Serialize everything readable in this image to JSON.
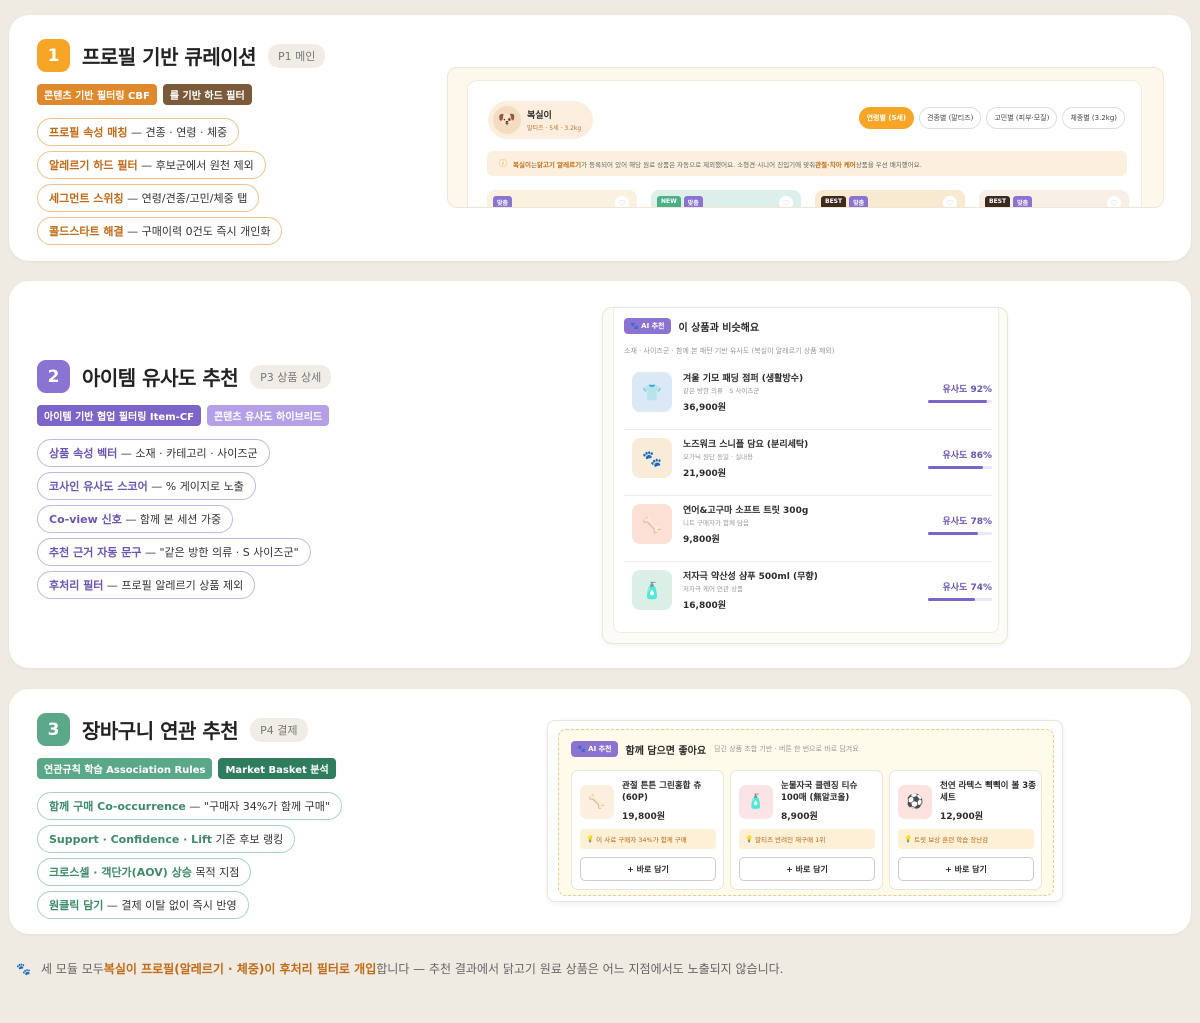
{
  "sections": [
    {
      "num": "1",
      "title": "프로필 기반 큐레이션",
      "page": "P1 메인",
      "chips": [
        "콘텐츠 기반 필터링 CBF",
        "룰 기반 하드 필터"
      ],
      "pills": [
        {
          "b": "프로필 속성 매칭",
          "t": " — 견종 · 연령 · 체중"
        },
        {
          "b": "알레르기 하드 필터",
          "t": " — 후보군에서 원천 제외"
        },
        {
          "b": "세그먼트 스위칭",
          "t": " — 연령/견종/고민/체중 탭"
        },
        {
          "b": "콜드스타트 해결",
          "t": " — 구매이력 0건도 즉시 개인화"
        }
      ]
    },
    {
      "num": "2",
      "title": "아이템 유사도 추천",
      "page": "P3 상품 상세",
      "chips": [
        "아이템 기반 협업 필터링 Item-CF",
        "콘텐츠 유사도 하이브리드"
      ],
      "pills": [
        {
          "b": "상품 속성 벡터",
          "t": " — 소재 · 카테고리 · 사이즈군"
        },
        {
          "b": "코사인 유사도 스코어",
          "t": " — % 게이지로 노출"
        },
        {
          "b": "Co-view 신호",
          "t": " — 함께 본 세션 가중"
        },
        {
          "b": "추천 근거 자동 문구",
          "t": " — \"같은 방한 의류 · S 사이즈군\""
        },
        {
          "b": "후처리 필터",
          "t": " — 프로필 알레르기 상품 제외"
        }
      ]
    },
    {
      "num": "3",
      "title": "장바구니 연관 추천",
      "page": "P4 결제",
      "chips": [
        "연관규칙 학습 Association Rules",
        "Market Basket 분석"
      ],
      "pills": [
        {
          "b": "함께 구매 Co-occurrence",
          "t": " — \"구매자 34%가 함께 구매\""
        },
        {
          "b": "Support · Confidence · Lift",
          "t": " 기준 후보 랭킹"
        },
        {
          "b": "크로스셀 · 객단가(AOV) 상승",
          "t": " 목적 지점"
        },
        {
          "b": "원클릭 담기",
          "t": " — 결제 이탈 없이 즉시 반영"
        }
      ]
    }
  ],
  "mock1": {
    "pet_name": "복실이",
    "pet_sub": "말티즈 · 5세 · 3.2kg",
    "tabs": [
      "연령별 (5세)",
      "견종별 (말티즈)",
      "고민별 (피부·모질)",
      "체중별 (3.2kg)"
    ],
    "notice_b1": "복실이",
    "notice_t1": "는 ",
    "notice_b2": "닭고기 알레르기",
    "notice_t2": "가 등록되어 있어 해당 원료 상품은 자동으로 제외했어요. 소형견·시니어 진입기에 맞춰 ",
    "notice_b3": "관절·치아 케어",
    "notice_t3": " 상품을 우선 배치했어요.",
    "badges": [
      [
        "맞춤"
      ],
      [
        "NEW",
        "맞춤"
      ],
      [
        "BEST",
        "맞춤"
      ],
      [
        "BEST",
        "맞춤"
      ]
    ]
  },
  "mock2": {
    "badge": "AI 추천",
    "title": "이 상품과 비슷해요",
    "sub": "소재 · 사이즈군 · 함께 본 패턴 기반 유사도 (복실이 알레르기 상품 제외)",
    "items": [
      {
        "name": "겨울 기모 패딩 점퍼 (생활방수)",
        "desc": "같은 방한 의류 · S 사이즈군",
        "price": "36,900원",
        "score": "유사도 92%",
        "pct": 92
      },
      {
        "name": "노즈워크 스니플 담요 (분리세탁)",
        "desc": "오가닉 원단 동일 · 실내용",
        "price": "21,900원",
        "score": "유사도 86%",
        "pct": 86
      },
      {
        "name": "연어&고구마 소프트 트릿 300g",
        "desc": "니트 구매자가 함께 담음",
        "price": "9,800원",
        "score": "유사도 78%",
        "pct": 78
      },
      {
        "name": "저자극 약산성 샴푸 500ml (무향)",
        "desc": "저자극 케어 연관 상품",
        "price": "16,800원",
        "score": "유사도 74%",
        "pct": 74
      }
    ]
  },
  "mock3": {
    "badge": "AI 추천",
    "title": "함께 담으면 좋아요",
    "sub": "담긴 상품 조합 기반 · 버튼 한 번으로 바로 담겨요",
    "items": [
      {
        "name": "관절 튼튼 그린홍합 츄 (60P)",
        "price": "19,800원",
        "tip": "이 사료 구매자 34%가 함께 구매",
        "btn": "+ 바로 담기"
      },
      {
        "name": "눈물자국 클렌징 티슈 100매 (無알코올)",
        "price": "8,900원",
        "tip": "말티즈 반려인 재구매 1위",
        "btn": "+ 바로 담기"
      },
      {
        "name": "천연 라텍스 삑삑이 볼 3종 세트",
        "price": "12,900원",
        "tip": "트릿 보상 훈련 학습 장난감",
        "btn": "+ 바로 담기"
      }
    ]
  },
  "footer": {
    "t1": "세 모듈 모두 ",
    "b": "복실이 프로필(알레르기 · 체중)이 후처리 필터로 개입",
    "t2": "합니다 — 추천 결과에서 닭고기 원료 상품은 어느 지점에서도 노출되지 않습니다."
  },
  "colors": {
    "orange": "#f6a524",
    "purple": "#8b73d1",
    "green": "#5aa887"
  }
}
